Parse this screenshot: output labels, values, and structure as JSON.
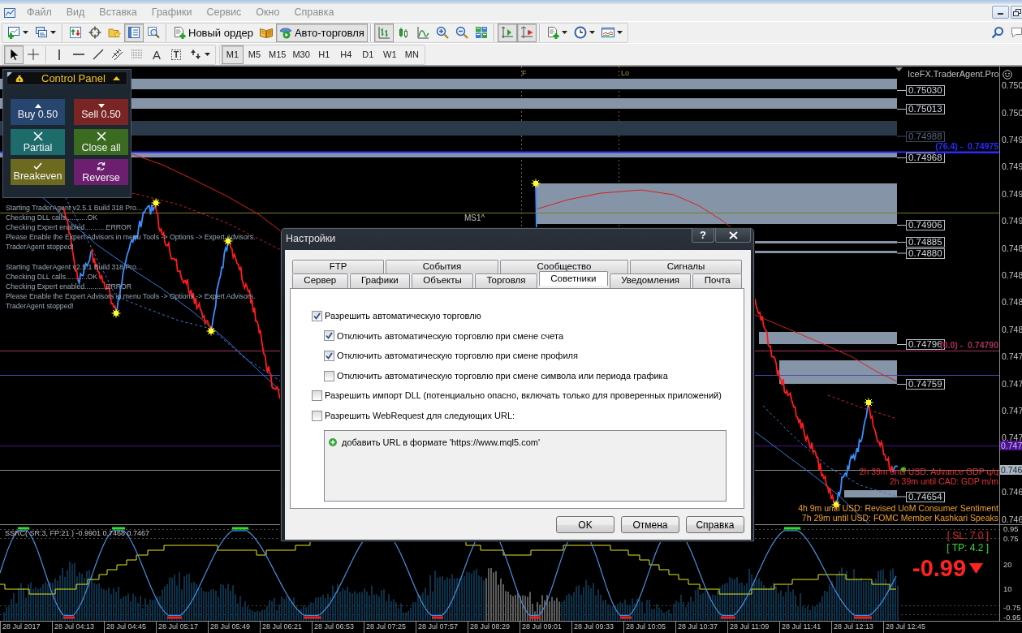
{
  "menu": [
    "Файл",
    "Вид",
    "Вставка",
    "Графики",
    "Сервис",
    "Окно",
    "Справка"
  ],
  "toolbar_main": [
    [
      {
        "pressed": false
      },
      {
        "pressed": false
      }
    ],
    [
      {
        "pressed": false
      },
      {
        "pressed": false
      },
      {
        "pressed": false
      },
      {
        "pressed": true
      },
      {
        "pressed": false
      }
    ],
    [
      {
        "label": "Новый ордер",
        "pressed": false
      },
      {
        "pressed": false
      },
      {
        "label": "Авто-торговля",
        "pressed": true
      }
    ],
    [
      {
        "pressed": true
      },
      {
        "pressed": false
      },
      {
        "pressed": false
      },
      {
        "pressed": false
      },
      {
        "pressed": false
      },
      {
        "pressed": false
      }
    ],
    [
      {
        "pressed": true
      },
      {
        "pressed": true
      }
    ],
    [
      {
        "pressed": false
      },
      {
        "pressed": false
      },
      {
        "pressed": false
      }
    ]
  ],
  "toolbar_drawing": [
    [
      {
        "pressed": true
      },
      {
        "pressed": false
      }
    ],
    [
      {
        "pressed": false
      },
      {
        "pressed": false
      },
      {
        "pressed": false
      },
      {
        "pressed": false
      },
      {
        "pressed": false
      },
      {
        "label": "A",
        "pressed": false
      },
      {
        "label": "T",
        "pressed": false
      },
      {
        "pressed": false
      }
    ]
  ],
  "timeframes": [
    {
      "label": "M1",
      "selected": true
    },
    {
      "label": "M5",
      "selected": false
    },
    {
      "label": "M15",
      "selected": false
    },
    {
      "label": "M30",
      "selected": false
    },
    {
      "label": "H1",
      "selected": false
    },
    {
      "label": "H4",
      "selected": false
    },
    {
      "label": "D1",
      "selected": false
    },
    {
      "label": "W1",
      "selected": false
    },
    {
      "label": "MN",
      "selected": false
    }
  ],
  "chart": {
    "line_markers": [
      "F",
      "Lo"
    ],
    "expert_name": "IceFX.TraderAgent.Pro",
    "zones": [
      {
        "label": "0.75030",
        "faded": false
      },
      {
        "label": "0.75013",
        "faded": false
      },
      {
        "label": "0.74988",
        "faded": true
      },
      {
        "label": "0.74968",
        "faded": false
      },
      {
        "label": "0.74906",
        "faded": false
      },
      {
        "label": "0.74885",
        "faded": false
      },
      {
        "label": "0.74880",
        "faded": false
      },
      {
        "label": "0.74796",
        "faded": false
      },
      {
        "label": "0.74759",
        "faded": false
      },
      {
        "label": "0.74654",
        "faded": false
      }
    ],
    "fib_levels": [
      {
        "label": "(76.4) -  0.74975",
        "color": "#2b2bff"
      },
      {
        "label": "(0.0) -  0.74790",
        "color": "#a8305c"
      }
    ],
    "pivot_label": "MS1^",
    "news": [
      {
        "text": "2h 39m until USD: Advance GDP q/q",
        "color": "#e33131"
      },
      {
        "text": "2h 39m until CAD: GDP m/m",
        "color": "#e33131"
      },
      {
        "text": "4h 9m until USD: Revised UoM Consumer Sentiment",
        "color": "#f0a030"
      },
      {
        "text": "7h 29m until USD: FOMC Member Kashkari Speaks",
        "color": "#f0a030"
      }
    ],
    "price_axis": [
      "0.750",
      "0.750",
      "0.749",
      "0.749",
      "0.749",
      "0.749",
      "0.748",
      "0.748",
      "0.748",
      "0.748",
      "0.747",
      "0.747",
      "0.747",
      "0.747",
      "0.746",
      "0.746"
    ],
    "price_markers": [
      {
        "text": "0.747",
        "color": "#4b128c"
      },
      {
        "text": "0.746",
        "color": "#aab6c2"
      }
    ]
  },
  "control_panel": {
    "title": "Control Panel",
    "buttons": [
      {
        "kind": "buy",
        "label": "Buy 0.50",
        "color": "#27466f"
      },
      {
        "kind": "sell",
        "label": "Sell 0.50",
        "color": "#7b2424"
      },
      {
        "kind": "partial",
        "label": "Partial",
        "color": "#1d6b6b"
      },
      {
        "kind": "close_all",
        "label": "Close all",
        "color": "#3b6b20"
      },
      {
        "kind": "breakeven",
        "label": "Breakeven",
        "color": "#6b6a1f"
      },
      {
        "kind": "reverse",
        "label": "Reverse",
        "color": "#6b1f6e"
      }
    ]
  },
  "log_blocks": [
    [
      "Starting TraderAgent v2.5.1 Build 318 Pro...",
      "Checking DLL calls...........OK",
      "Checking Expert enabled...........ERROR",
      "Please Enable the Expert Advisors in menu Tools -> Options -> Expert Advisors.",
      "TraderAgent stopped!"
    ],
    [
      "Starting TraderAgent v2.5.1 Build 318 Pro...",
      "Checking DLL calls...........OK",
      "Checking Expert enabled...........ERROR",
      "Please Enable the Expert Advisors in menu Tools -> Options -> Expert Advisors.",
      "TraderAgent stopped!"
    ]
  ],
  "oscillator": {
    "label": "SSRC( SR:3, FP:21 ) -0.9901 0.7468 0.7467",
    "stop_loss": "[ SL: 7.0 ]",
    "take_profit": "[ TP: 4.2 ]",
    "signal": "-0.99",
    "axis": [
      "0.95",
      "0.75",
      "20",
      "10",
      "-0.75",
      "-0.95"
    ]
  },
  "time_axis": [
    "28 Jul 2017",
    "28 Jul 04:13",
    "28 Jul 04:45",
    "28 Jul 05:17",
    "28 Jul 05:49",
    "28 Jul 06:21",
    "28 Jul 06:53",
    "28 Jul 07:25",
    "28 Jul 07:57",
    "28 Jul 08:29",
    "28 Jul 09:01",
    "28 Jul 09:33",
    "28 Jul 10:05",
    "28 Jul 10:37",
    "28 Jul 11:09",
    "28 Jul 11:41",
    "28 Jul 12:13",
    "28 Jul 12:45"
  ],
  "dialog": {
    "title": "Настройки",
    "help_button": "?",
    "tab_rows": [
      [
        {
          "label": "FTP",
          "selected": false
        },
        {
          "label": "События",
          "selected": false
        },
        {
          "label": "Сообщество",
          "selected": false
        },
        {
          "label": "Сигналы",
          "selected": false
        }
      ],
      [
        {
          "label": "Сервер",
          "selected": false
        },
        {
          "label": "Графики",
          "selected": false
        },
        {
          "label": "Объекты",
          "selected": false
        },
        {
          "label": "Торговля",
          "selected": false
        },
        {
          "label": "Советники",
          "selected": true
        },
        {
          "label": "Уведомления",
          "selected": false
        },
        {
          "label": "Почта",
          "selected": false
        }
      ]
    ],
    "options": [
      {
        "label": "Разрешить автоматическую торговлю",
        "checked": true,
        "children": [
          {
            "label": "Отключить автоматическую торговлю при смене счета",
            "checked": true
          },
          {
            "label": "Отключить автоматическую торговлю при смене профиля",
            "checked": true
          },
          {
            "label": "Отключить автоматическую торговлю при смене символа или периода графика",
            "checked": false
          }
        ]
      },
      {
        "label": "Разрешить импорт DLL (потенциально опасно, включать только для проверенных приложений)",
        "checked": false
      },
      {
        "label": "Разрешить WebRequest для следующих URL:",
        "checked": false
      }
    ],
    "url_list": [
      "добавить URL в формате 'https://www.mql5.com'"
    ],
    "buttons": [
      "OK",
      "Отмена",
      "Справка"
    ]
  }
}
